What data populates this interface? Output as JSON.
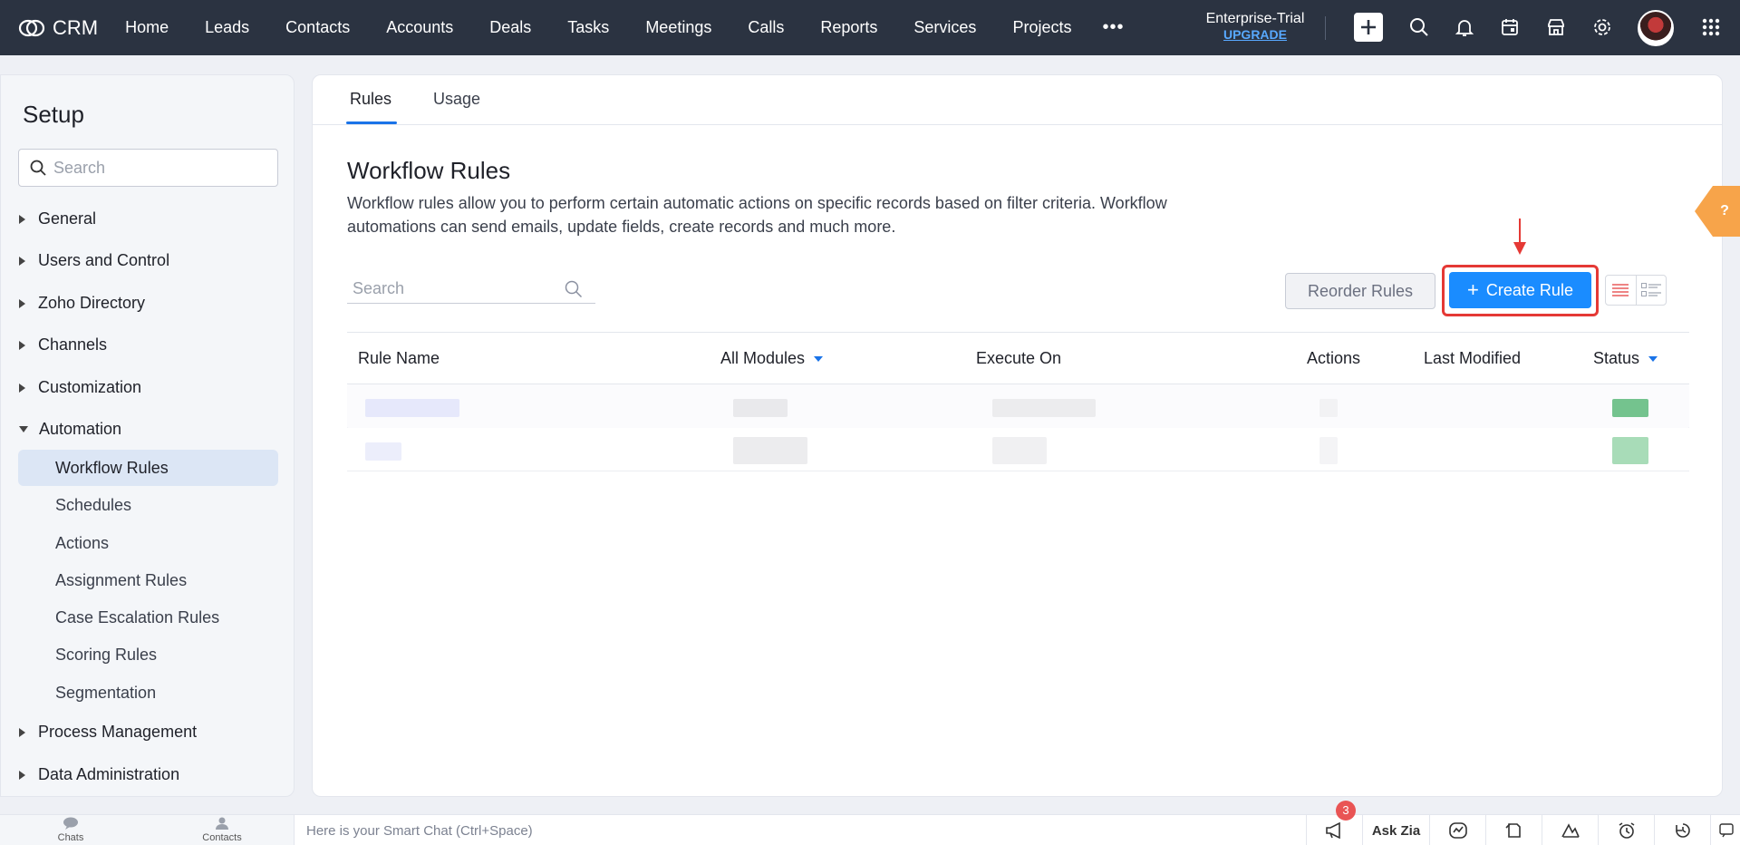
{
  "topbar": {
    "app_name": "CRM",
    "nav": [
      "Home",
      "Leads",
      "Contacts",
      "Accounts",
      "Deals",
      "Tasks",
      "Meetings",
      "Calls",
      "Reports",
      "Services",
      "Projects"
    ],
    "more": "•••",
    "plan": "Enterprise-Trial",
    "upgrade": "UPGRADE",
    "icons": [
      "add-icon",
      "search-icon",
      "bell-icon",
      "calendar-icon",
      "marketplace-icon",
      "gear-icon",
      "avatar",
      "apps-grid-icon"
    ]
  },
  "sidebar": {
    "title": "Setup",
    "search_placeholder": "Search",
    "sections": [
      "General",
      "Users and Control",
      "Zoho Directory",
      "Channels",
      "Customization",
      "Automation"
    ],
    "automation_items": [
      "Workflow Rules",
      "Schedules",
      "Actions",
      "Assignment Rules",
      "Case Escalation Rules",
      "Scoring Rules",
      "Segmentation"
    ],
    "sections_after": [
      "Process Management",
      "Data Administration"
    ],
    "active_item": "Workflow Rules"
  },
  "main": {
    "tabs": [
      "Rules",
      "Usage"
    ],
    "active_tab": "Rules",
    "title": "Workflow Rules",
    "description": "Workflow rules allow you to perform certain automatic actions on specific records based on filter criteria. Workflow automations can send emails, update fields, create records and much more.",
    "search_placeholder": "Search",
    "reorder_label": "Reorder Rules",
    "create_label": "Create Rule",
    "create_plus": "+",
    "columns": [
      "Rule Name",
      "All Modules",
      "Execute On",
      "Actions",
      "Last Modified",
      "Status"
    ]
  },
  "help": "?",
  "bottombar": {
    "chats": "Chats",
    "contacts": "Contacts",
    "smart_chat": "Here is your Smart Chat (Ctrl+Space)",
    "badge": "3",
    "ask_zia": "Ask Zia"
  },
  "colors": {
    "topbar": "#2b3341",
    "accent": "#1a8cff",
    "highlight": "#e53935",
    "status_on": "#5cb87a"
  }
}
